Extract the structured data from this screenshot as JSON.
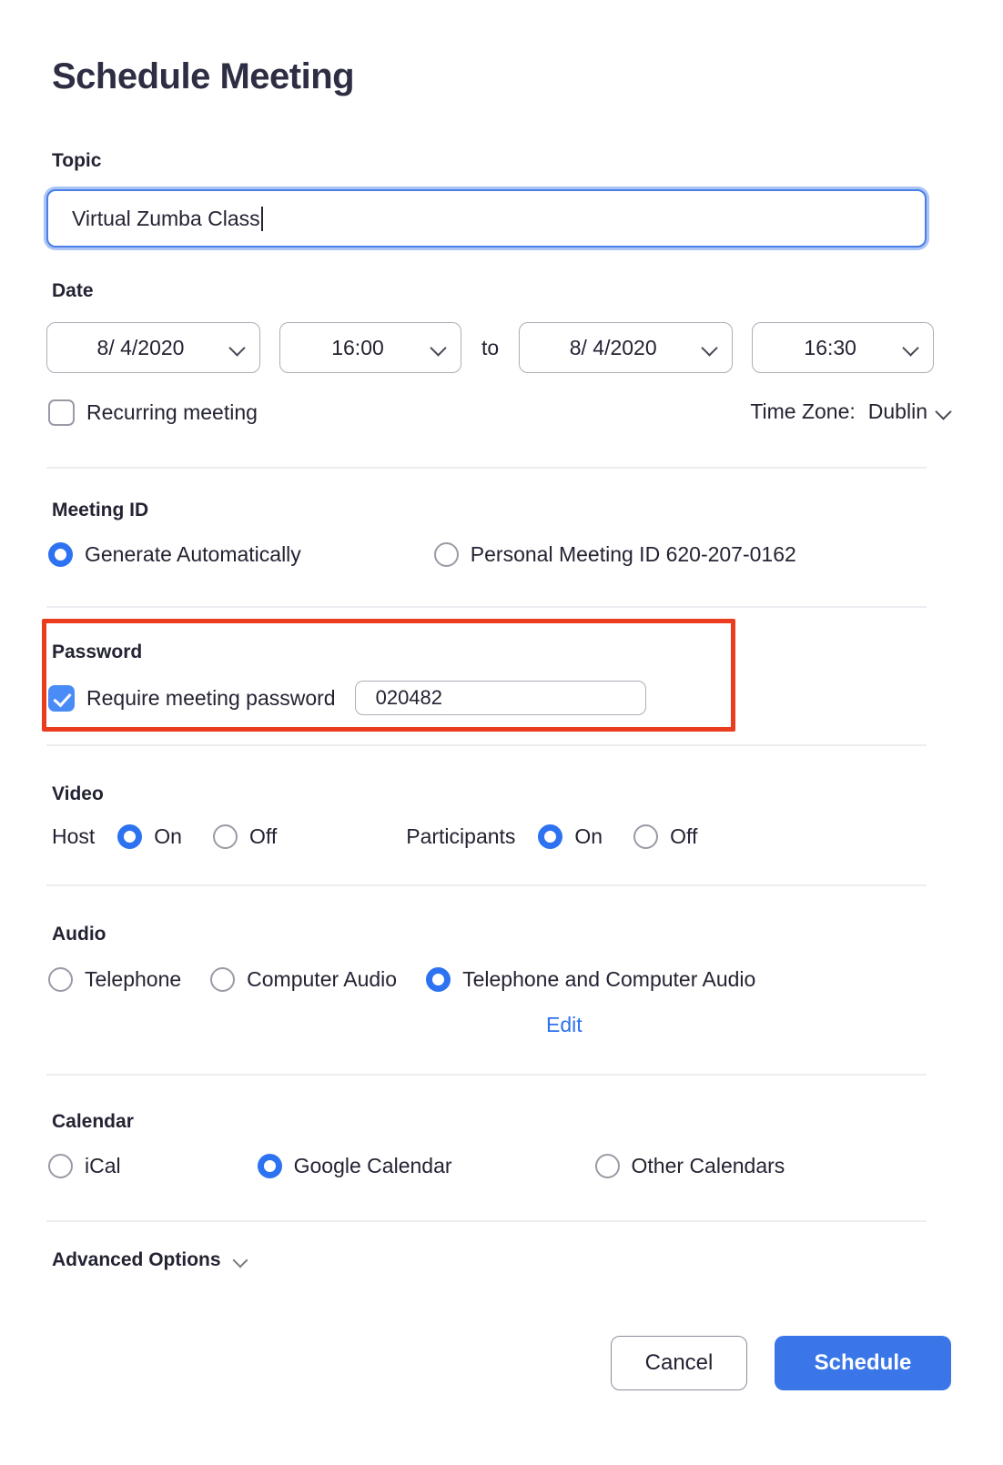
{
  "dialog": {
    "title": "Schedule Meeting"
  },
  "topic": {
    "label": "Topic",
    "value": "Virtual Zumba Class"
  },
  "date": {
    "label": "Date",
    "start_date": "8/ 4/2020",
    "start_time": "16:00",
    "separator": "to",
    "end_date": "8/ 4/2020",
    "end_time": "16:30",
    "recurring_label": "Recurring meeting",
    "recurring_checked": false,
    "timezone_label": "Time Zone:",
    "timezone_value": "Dublin"
  },
  "meeting_id": {
    "label": "Meeting ID",
    "options": [
      {
        "label": "Generate Automatically",
        "selected": true
      },
      {
        "label": "Personal Meeting ID 620-207-0162",
        "selected": false
      }
    ]
  },
  "password": {
    "label": "Password",
    "require_label": "Require meeting password",
    "require_checked": true,
    "value": "020482",
    "highlight_color": "#ea3d20"
  },
  "video": {
    "label": "Video",
    "host_label": "Host",
    "host_on": "On",
    "host_off": "Off",
    "host_selected": "On",
    "participants_label": "Participants",
    "participants_on": "On",
    "participants_off": "Off",
    "participants_selected": "On"
  },
  "audio": {
    "label": "Audio",
    "options": [
      {
        "label": "Telephone",
        "selected": false
      },
      {
        "label": "Computer Audio",
        "selected": false
      },
      {
        "label": "Telephone and Computer Audio",
        "selected": true
      }
    ],
    "edit_link": "Edit"
  },
  "calendar": {
    "label": "Calendar",
    "options": [
      {
        "label": "iCal",
        "selected": false
      },
      {
        "label": "Google Calendar",
        "selected": true
      },
      {
        "label": "Other Calendars",
        "selected": false
      }
    ]
  },
  "advanced": {
    "label": "Advanced Options"
  },
  "footer": {
    "cancel_label": "Cancel",
    "schedule_label": "Schedule"
  },
  "colors": {
    "accent_blue": "#2d72f0",
    "primary_button": "#3a76e8",
    "highlight_red": "#ea3d20",
    "text": "#232333"
  }
}
